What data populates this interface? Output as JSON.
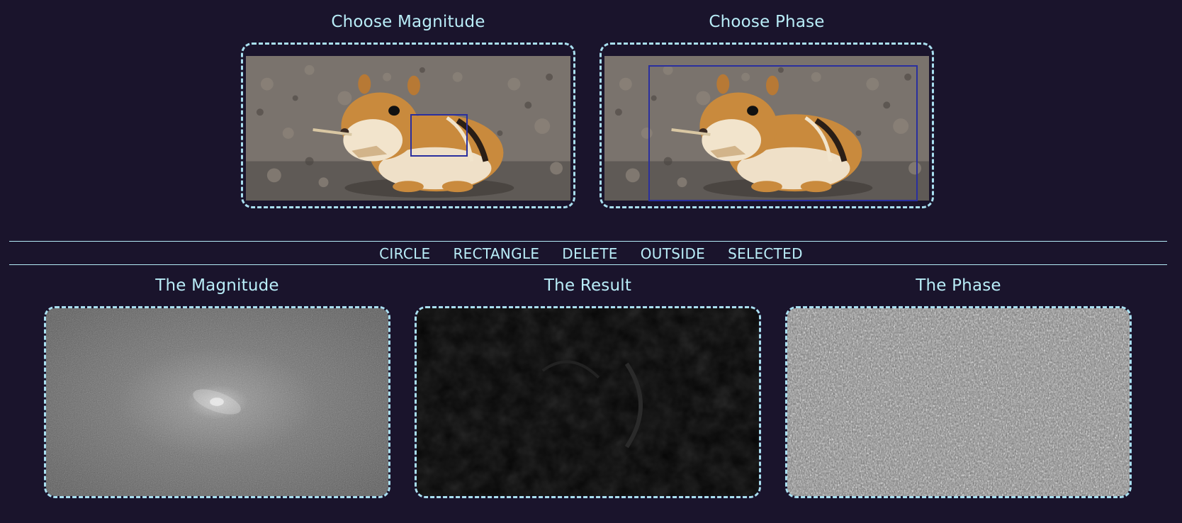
{
  "top": {
    "magnitude": {
      "title": "Choose Magnitude",
      "image": "chipmunk-photo"
    },
    "phase": {
      "title": "Choose Phase",
      "image": "chipmunk-photo"
    }
  },
  "toolbar": {
    "buttons": [
      "CIRCLE",
      "RECTANGLE",
      "DELETE",
      "OUTSIDE",
      "SELECTED"
    ]
  },
  "bottom": {
    "magnitude": {
      "title": "The Magnitude",
      "image": "fft-magnitude-spectrum"
    },
    "result": {
      "title": "The Result",
      "image": "reconstructed-result"
    },
    "phase": {
      "title": "The Phase",
      "image": "fft-phase-spectrum"
    }
  },
  "colors": {
    "background": "#1a142c",
    "accent": "#b4ecf7",
    "selection": "#2a2f9e"
  }
}
